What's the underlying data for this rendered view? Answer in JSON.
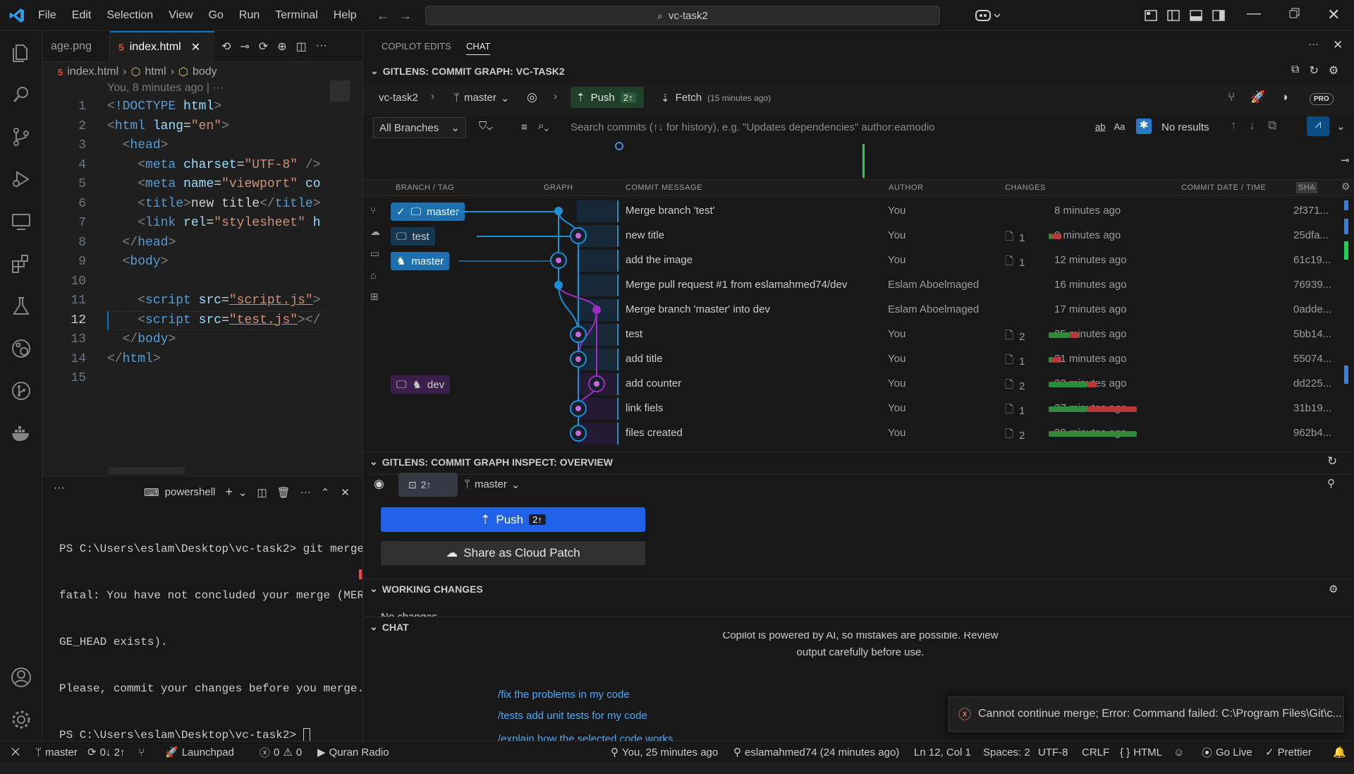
{
  "titlebar": {
    "menu": [
      "File",
      "Edit",
      "Selection",
      "View",
      "Go",
      "Run",
      "Terminal",
      "Help"
    ],
    "search": "vc-task2"
  },
  "editor": {
    "tabs": [
      {
        "label": "age.png"
      },
      {
        "label": "index.html",
        "active": true
      }
    ],
    "breadcrumb": [
      "index.html",
      "html",
      "body"
    ],
    "blame": "You, 8 minutes ago | ···",
    "lines": [
      "1",
      "2",
      "3",
      "4",
      "5",
      "6",
      "7",
      "8",
      "9",
      "10",
      "11",
      "12",
      "13",
      "14",
      "15"
    ],
    "active_line": "12"
  },
  "terminal": {
    "more": "···",
    "shell": "powershell",
    "lines": [
      "PS C:\\Users\\eslam\\Desktop\\vc-task2> git merge",
      "fatal: You have not concluded your merge (MER",
      "GE_HEAD exists).",
      "Please, commit your changes before you merge.",
      "PS C:\\Users\\eslam\\Desktop\\vc-task2> "
    ],
    "cmd": "git merge"
  },
  "right": {
    "tabs": [
      "COPILOT EDITS",
      "CHAT"
    ],
    "graph_section": "GITLENS: COMMIT GRAPH: VC-TASK2",
    "repo": "vc-task2",
    "branch": "master",
    "push_label": "Push",
    "push_count": "2",
    "fetch_label": "Fetch",
    "fetch_time": "(15 minutes ago)",
    "pro": "PRO",
    "branches_filter": "All Branches",
    "search_placeholder": "Search commits (↑↓ for history), e.g. \"Updates dependencies\" author:eamodio",
    "search_opts": [
      "ab",
      "Aa"
    ],
    "no_results": "No results",
    "columns": [
      "BRANCH / TAG",
      "GRAPH",
      "COMMIT MESSAGE",
      "AUTHOR",
      "CHANGES",
      "COMMIT DATE / TIME",
      "SHA"
    ],
    "commits": [
      {
        "branch": "master",
        "message": "Merge branch 'test'",
        "author": "You",
        "files": "",
        "date": "8 minutes ago",
        "sha": "2f371...",
        "add": 0,
        "del": 0
      },
      {
        "branch": "test",
        "message": "new title",
        "author": "You",
        "files": "1",
        "date": "8 minutes ago",
        "sha": "25dfa...",
        "add": 0.04,
        "del": 0.1
      },
      {
        "branch": "master",
        "message": "add the image",
        "author": "You",
        "files": "1",
        "date": "12 minutes ago",
        "sha": "61c19...",
        "add": 0,
        "del": 0
      },
      {
        "branch": "",
        "message": "Merge pull request #1 from eslamahmed74/dev",
        "author": "Eslam Aboelmaged",
        "files": "",
        "date": "16 minutes ago",
        "sha": "76939...",
        "add": 0,
        "del": 0
      },
      {
        "branch": "",
        "message": "Merge branch 'master' into dev",
        "author": "Eslam Aboelmaged",
        "files": "",
        "date": "17 minutes ago",
        "sha": "0adde...",
        "add": 0,
        "del": 0
      },
      {
        "branch": "",
        "message": "test",
        "author": "You",
        "files": "2",
        "date": "25 minutes ago",
        "sha": "5bb14...",
        "add": 0.24,
        "del": 0.1
      },
      {
        "branch": "",
        "message": "add title",
        "author": "You",
        "files": "1",
        "date": "31 minutes ago",
        "sha": "55074...",
        "add": 0.04,
        "del": 0.1
      },
      {
        "branch": "dev",
        "message": "add counter",
        "author": "You",
        "files": "2",
        "date": "32 minutes ago",
        "sha": "dd225...",
        "add": 0.44,
        "del": 0.1
      },
      {
        "branch": "",
        "message": "link fiels",
        "author": "You",
        "files": "1",
        "date": "37 minutes ago",
        "sha": "31b19...",
        "add": 0.44,
        "del": 0.56
      },
      {
        "branch": "",
        "message": "files created",
        "author": "You",
        "files": "2",
        "date": "39 minutes ago",
        "sha": "962b4...",
        "add": 1.0,
        "del": 0
      }
    ],
    "inspect_section": "GITLENS: COMMIT GRAPH INSPECT: OVERVIEW",
    "inspect_count": "2",
    "inspect_branch": "master",
    "push_button": "Push",
    "share_button": "Share as Cloud Patch",
    "working_section": "WORKING CHANGES",
    "no_changes": "No changes",
    "chat_section": "CHAT",
    "copilot_note_1": "Copilot is powered by AI, so mistakes are possible. Review",
    "copilot_note_2": "output carefully before use.",
    "suggestions": [
      {
        "cmd": "/fix",
        "text": "the problems in my code"
      },
      {
        "cmd": "/tests",
        "text": "add unit tests for my code"
      },
      {
        "cmd": "/explain",
        "text": "how the selected code works"
      }
    ]
  },
  "toast": {
    "message": "Cannot continue merge; Error: Command failed: C:\\Program Files\\Git\\c..."
  },
  "status": {
    "branch": "master",
    "sync": "0↓ 2↑",
    "launchpad": "Launchpad",
    "errors": "0",
    "warnings": "0",
    "radio": "Quran Radio",
    "blame": "You, 25 minutes ago",
    "author": "eslamahmed74 (24 minutes ago)",
    "position": "Ln 12, Col 1",
    "spaces": "Spaces: 2",
    "encoding": "UTF-8",
    "eol": "CRLF",
    "language": "HTML",
    "golive": "Go Live",
    "prettier": "Prettier"
  },
  "colors": {
    "accent": "#0078d4",
    "push": "#2162e8",
    "green": "#2e8b3e",
    "red": "#b8383b",
    "branch_blue": "#1e8fd6",
    "branch_purple": "#9b2fc2"
  }
}
